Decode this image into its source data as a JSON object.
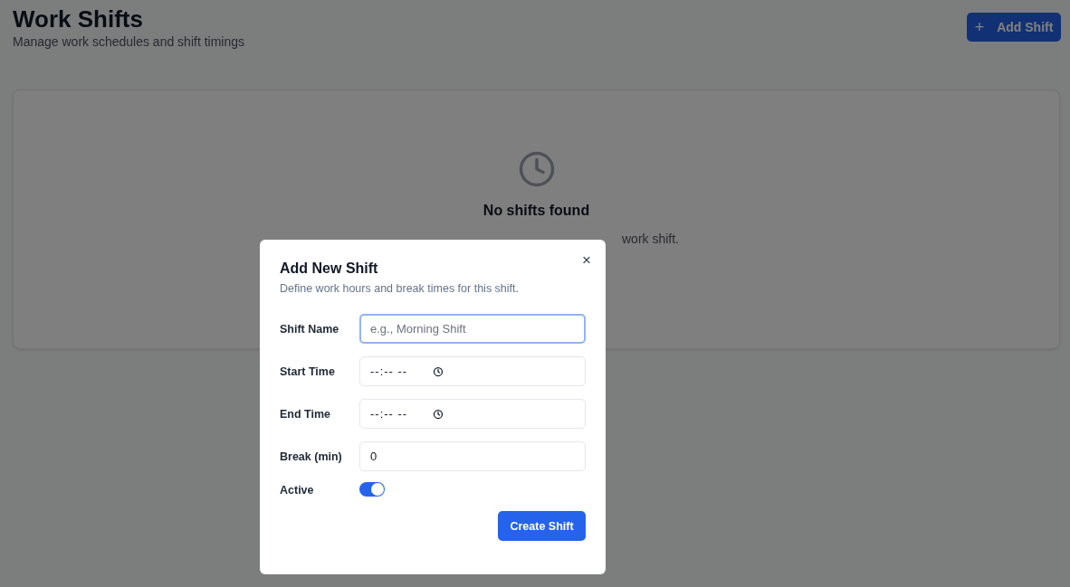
{
  "page": {
    "title": "Work Shifts",
    "subtitle": "Manage work schedules and shift timings",
    "add_button": {
      "icon": "+",
      "label": "Add Shift"
    }
  },
  "empty_state": {
    "title": "No shifts found",
    "description_visible": "work shift."
  },
  "dialog": {
    "title": "Add New Shift",
    "description": "Define work hours and break times for this shift.",
    "close": "×",
    "fields": [
      {
        "kind": "text",
        "label": "Shift Name",
        "placeholder": "e.g., Morning Shift",
        "focused": true
      },
      {
        "kind": "time",
        "label": "Start Time",
        "value": "--:-- --",
        "focused": false
      },
      {
        "kind": "time",
        "label": "End Time",
        "value": "--:-- --",
        "focused": false
      },
      {
        "kind": "number",
        "label": "Break (min)",
        "value": "0",
        "focused": false
      },
      {
        "kind": "toggle",
        "label": "Active",
        "on": true
      }
    ],
    "submit": "Create Shift"
  }
}
